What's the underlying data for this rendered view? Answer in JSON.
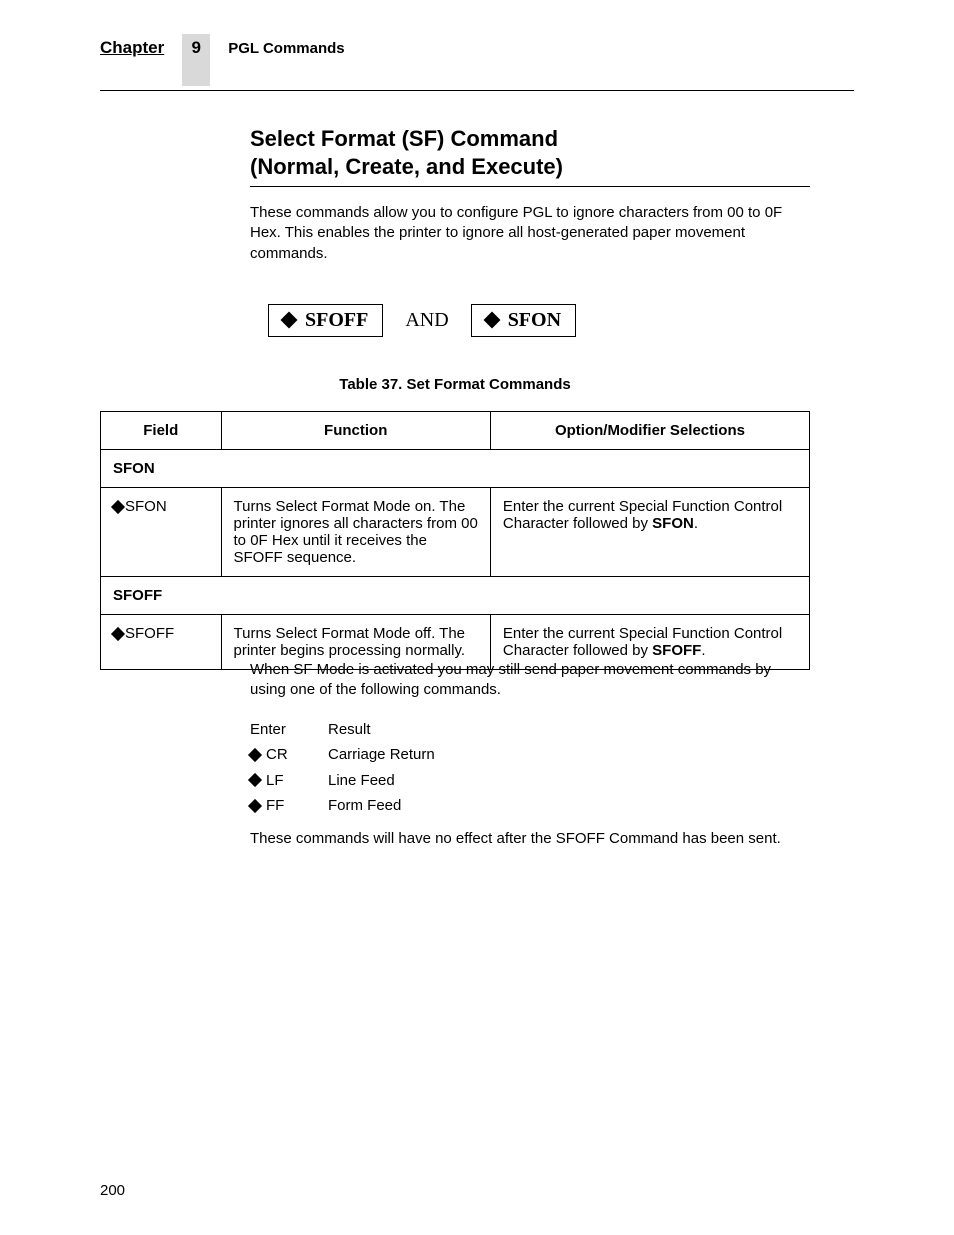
{
  "header": {
    "chapter_label": "Chapter",
    "chapter_number": "9",
    "title": "PGL Commands"
  },
  "section": {
    "title_line1": "Select Format (SF) Command",
    "title_line2": "(Normal, Create, and Execute)",
    "intro": "These commands allow you to configure PGL to ignore characters from 00 to 0F Hex. This enables the printer to ignore all host-generated paper movement commands."
  },
  "syntax": {
    "box1": "SFOFF",
    "and": "AND",
    "box2": "SFON"
  },
  "table": {
    "caption": "Table 37. Set Format Commands",
    "headers": {
      "field": "Field",
      "function": "Function",
      "option": "Option/Modifier Selections"
    },
    "subhead1": "SFON",
    "row1": {
      "field": "SFON",
      "function": "Turns Select Format Mode on. The printer ignores all characters from 00 to 0F Hex until it receives the SFOFF sequence.",
      "option_pre": "Enter the current Special Function Control Character followed by ",
      "option_bold": "SFON",
      "option_post": "."
    },
    "subhead2": "SFOFF",
    "row2": {
      "field": "SFOFF",
      "function": "Turns Select Format Mode off. The printer begins processing normally.",
      "option_pre": "Enter the current Special Function Control Character followed by ",
      "option_bold": "SFOFF",
      "option_post": "."
    }
  },
  "after": {
    "para1": "When SF Mode is activated you may still send paper movement commands by using one of the following commands.",
    "head_enter": "Enter",
    "head_result": "Result",
    "rows": [
      {
        "code": "CR",
        "result": "Carriage Return"
      },
      {
        "code": "LF",
        "result": "Line Feed"
      },
      {
        "code": "FF",
        "result": "Form Feed"
      }
    ],
    "para2": "These commands will have no effect after the SFOFF Command has been sent."
  },
  "page_number": "200"
}
